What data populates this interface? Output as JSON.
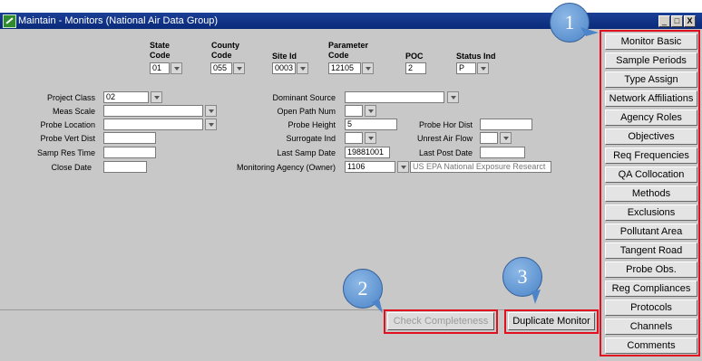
{
  "window": {
    "title": "Maintain - Monitors (National Air Data Group)",
    "minimize": "_",
    "maximize": "□",
    "close": "X"
  },
  "header": {
    "state_label": "State\nCode",
    "state_value": "01",
    "county_label": "County\nCode",
    "county_value": "055",
    "site_label": "Site Id",
    "site_value": "0003",
    "param_label": "Parameter\nCode",
    "param_value": "12105",
    "poc_label": "POC",
    "poc_value": "2",
    "status_label": "Status Ind",
    "status_value": "P"
  },
  "left_fields": {
    "project_class_label": "Project Class",
    "project_class_value": "02",
    "meas_scale_label": "Meas Scale",
    "meas_scale_value": "",
    "probe_location_label": "Probe Location",
    "probe_location_value": "",
    "probe_vert_dist_label": "Probe Vert Dist",
    "probe_vert_dist_value": "",
    "samp_res_time_label": "Samp Res Time",
    "samp_res_time_value": "",
    "close_date_label": "Close Date",
    "close_date_value": ""
  },
  "right_fields": {
    "dominant_source_label": "Dominant Source",
    "dominant_source_value": "",
    "open_path_num_label": "Open Path Num",
    "open_path_num_value": "",
    "probe_height_label": "Probe Height",
    "probe_height_value": "5",
    "probe_hor_dist_label": "Probe Hor Dist",
    "probe_hor_dist_value": "",
    "surrogate_ind_label": "Surrogate Ind",
    "surrogate_ind_value": "",
    "unrest_air_flow_label": "Unrest Air Flow",
    "unrest_air_flow_value": "",
    "last_samp_date_label": "Last Samp Date",
    "last_samp_date_value": "19881001",
    "last_post_date_label": "Last Post Date",
    "last_post_date_value": "",
    "monitoring_agency_label": "Monitoring Agency (Owner)",
    "monitoring_agency_code": "1106",
    "monitoring_agency_name": "US EPA National Exposure Researct"
  },
  "buttons": {
    "check_completeness": "Check Completeness",
    "duplicate_monitor": "Duplicate Monitor"
  },
  "sidebar": [
    "Monitor Basic",
    "Sample Periods",
    "Type Assign",
    "Network Affiliations",
    "Agency Roles",
    "Objectives",
    "Req Frequencies",
    "QA Collocation",
    "Methods",
    "Exclusions",
    "Pollutant Area",
    "Tangent Road",
    "Probe Obs.",
    "Reg Compliances",
    "Protocols",
    "Channels",
    "Comments"
  ],
  "callouts": {
    "one": "1",
    "two": "2",
    "three": "3"
  },
  "colors": {
    "highlight": "#e01020",
    "titlebar": "#0a2a7a",
    "callout": "#4b84c8"
  }
}
